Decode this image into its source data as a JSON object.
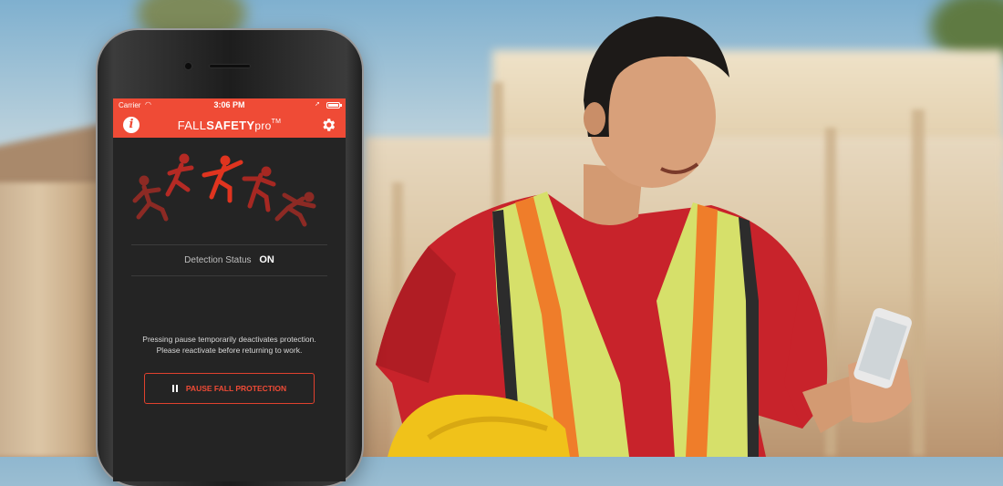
{
  "status_bar": {
    "carrier": "Carrier",
    "time": "3:06 PM"
  },
  "app": {
    "title_part1": "FALL",
    "title_part2": "SAFETY",
    "title_part3": "pro",
    "title_tm": "TM",
    "accent_color": "#ef4b36",
    "info_icon": "info-icon",
    "settings_icon": "gear-icon"
  },
  "detection": {
    "label": "Detection Status",
    "value": "ON"
  },
  "pause": {
    "note_line1": "Pressing pause temporarily deactivates protection.",
    "note_line2": "Please reactivate before returning to work.",
    "button_label": "PAUSE FALL PROTECTION",
    "button_icon": "pause-icon"
  }
}
